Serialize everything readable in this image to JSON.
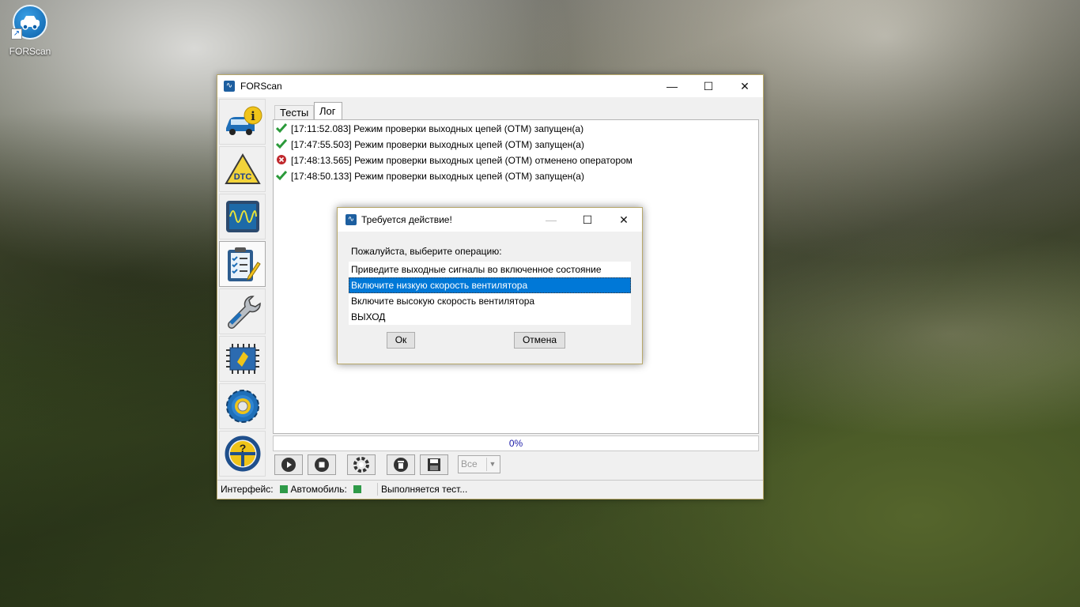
{
  "desktop": {
    "icon_label": "FORScan"
  },
  "window": {
    "title": "FORScan",
    "controls": {
      "minimize": "—",
      "maximize": "☐",
      "close": "✕"
    },
    "tabs": [
      {
        "label": "Тесты",
        "active": false
      },
      {
        "label": "Лог",
        "active": true
      }
    ],
    "sidebar": [
      {
        "icon": "vehicle-info-icon"
      },
      {
        "icon": "dtc-icon"
      },
      {
        "icon": "oscilloscope-icon"
      },
      {
        "icon": "checklist-icon",
        "active": true
      },
      {
        "icon": "wrench-icon"
      },
      {
        "icon": "chip-icon"
      },
      {
        "icon": "settings-gear-icon"
      },
      {
        "icon": "help-steering-wheel-icon"
      }
    ],
    "log": [
      {
        "status": "ok",
        "text": "[17:11:52.083] Режим проверки выходных цепей (OTM) запущен(а)"
      },
      {
        "status": "ok",
        "text": "[17:47:55.503] Режим проверки выходных цепей (OTM) запущен(а)"
      },
      {
        "status": "error",
        "text": "[17:48:13.565] Режим проверки выходных цепей (OTM) отменено оператором"
      },
      {
        "status": "ok",
        "text": "[17:48:50.133] Режим проверки выходных цепей (OTM) запущен(а)"
      }
    ],
    "progress": "0%",
    "toolbar": {
      "buttons": [
        "play-icon",
        "stop-icon",
        "lifebuoy-icon",
        "clear-icon",
        "save-icon"
      ],
      "filter_value": "Все"
    },
    "status": {
      "interface_label": "Интерфейс:",
      "vehicle_label": "Автомобиль:",
      "message": "Выполняется тест..."
    }
  },
  "dialog": {
    "title": "Требуется действие!",
    "prompt": "Пожалуйста, выберите операцию:",
    "options": [
      {
        "label": "Приведите выходные сигналы во включенное состояние",
        "selected": false
      },
      {
        "label": "Включите низкую скорость вентилятора",
        "selected": true
      },
      {
        "label": "Включите высокую скорость вентилятора",
        "selected": false
      },
      {
        "label": "ВЫХОД",
        "selected": false
      }
    ],
    "ok_label": "Ок",
    "cancel_label": "Отмена"
  },
  "colors": {
    "selection": "#0078d7",
    "status_led": "#2e9a48",
    "progress_text": "#1a1aa8",
    "ok_check": "#2b9a3a",
    "error_mark": "#c0282d"
  }
}
